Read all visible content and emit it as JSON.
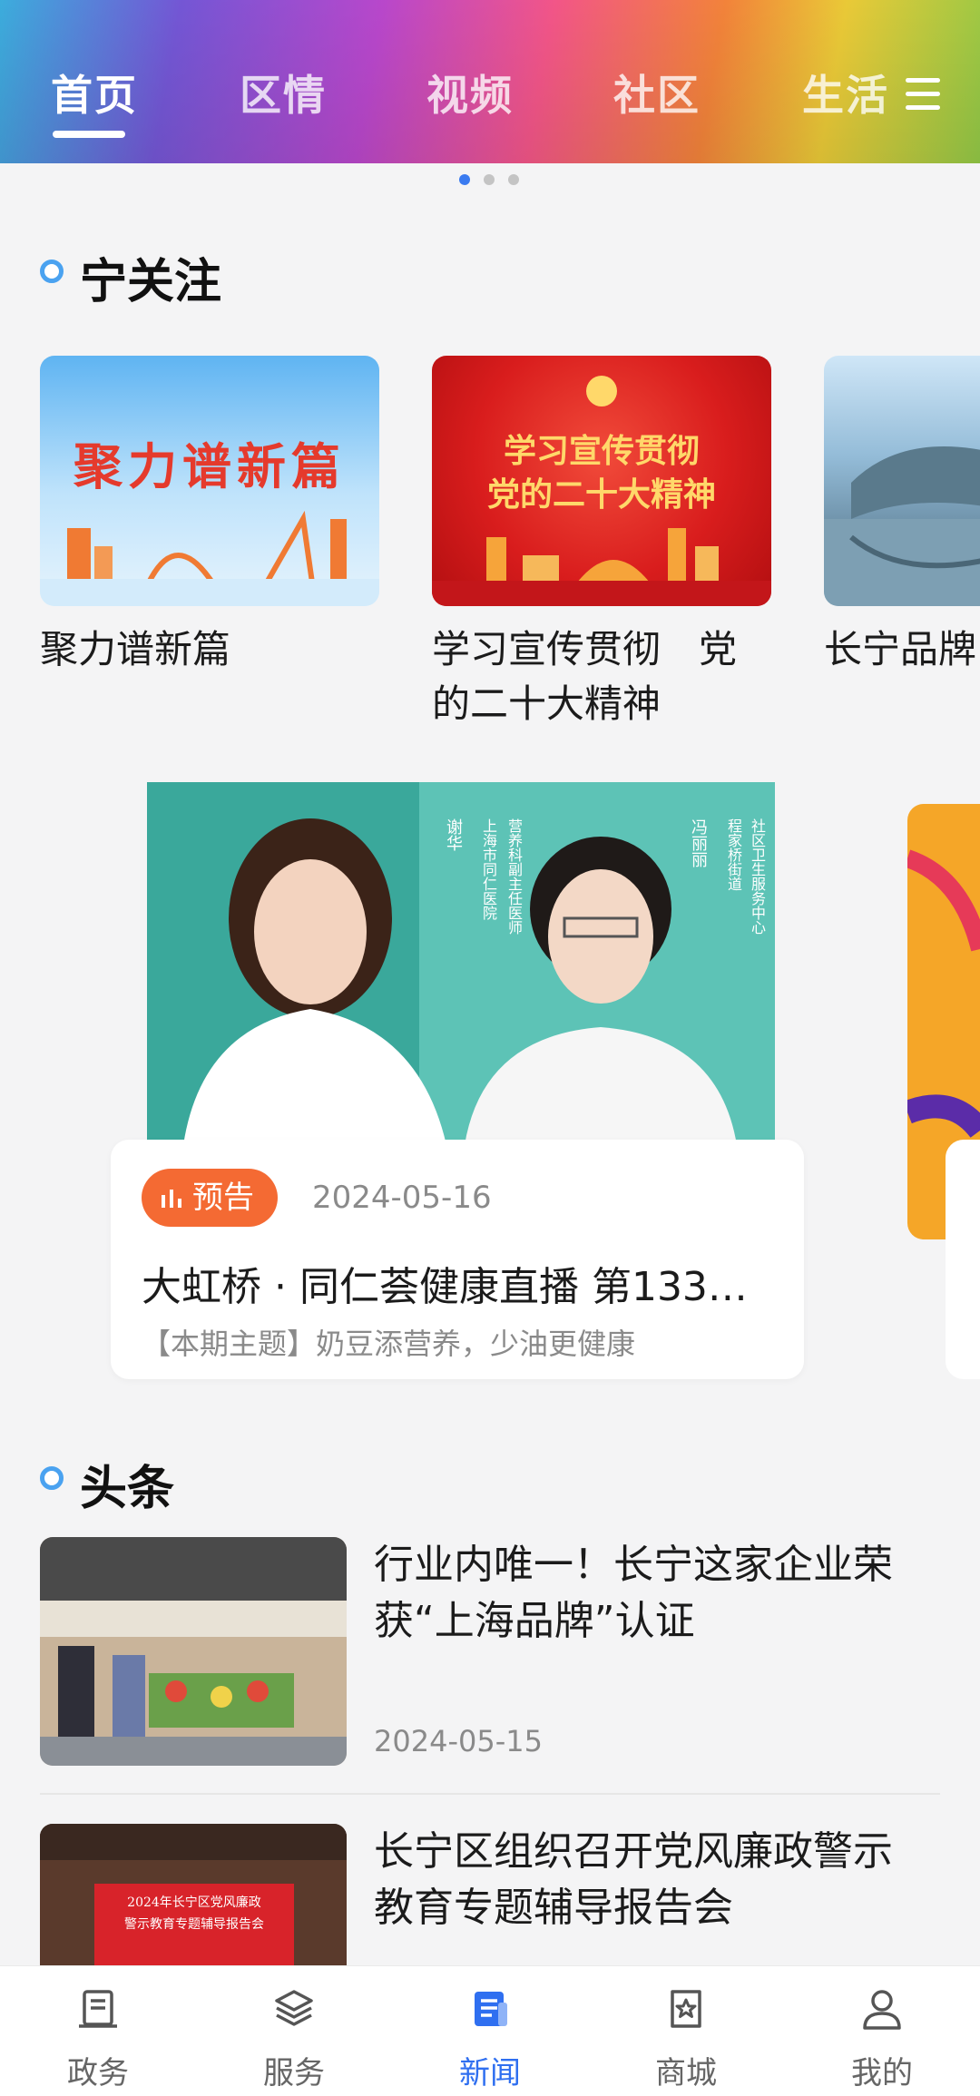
{
  "header": {
    "tabs": [
      {
        "label": "首页",
        "active": true
      },
      {
        "label": "区情",
        "active": false
      },
      {
        "label": "视频",
        "active": false
      },
      {
        "label": "社区",
        "active": false
      },
      {
        "label": "生活",
        "active": false
      }
    ],
    "menu_icon": "hamburger-menu-icon"
  },
  "carousel": {
    "pages": 3,
    "active_index": 0
  },
  "focus": {
    "title": "宁关注",
    "cards": [
      {
        "image_text": "聚力谱新篇",
        "caption": "聚力谱新篇"
      },
      {
        "image_text_line1": "学习宣传贯彻",
        "image_text_line2": "党的二十大精神",
        "caption_line1": "学习宣传贯彻　党",
        "caption_line2": "的二十大精神"
      },
      {
        "caption": "长宁品牌"
      }
    ]
  },
  "live": {
    "badge": "预告",
    "date": "2024-05-16",
    "title": "大虹桥 · 同仁荟健康直播 第133…",
    "subtitle": "【本期主题】奶豆添营养，少油更健康",
    "photo_text_left_name": "谢华",
    "photo_text_left_org": "上海市同仁医院",
    "photo_text_left_role": "营养科副主任医师",
    "photo_text_right_name": "冯丽丽",
    "photo_text_right_org": "程家桥街道",
    "photo_text_right_role": "社区卫生服务中心"
  },
  "headlines": {
    "title": "头条",
    "items": [
      {
        "title_line1": "行业内唯一！长宁这家企业荣",
        "title_line2": "获“上海品牌”认证",
        "date": "2024-05-15"
      },
      {
        "title_line1": "长宁区组织召开党风廉政警示",
        "title_line2": "教育专题辅导报告会",
        "thumb_line1": "2024年长宁区党风廉政",
        "thumb_line2": "警示教育专题辅导报告会"
      }
    ]
  },
  "bottom_nav": [
    {
      "label": "政务",
      "icon": "government-icon",
      "active": false
    },
    {
      "label": "服务",
      "icon": "layers-icon",
      "active": false
    },
    {
      "label": "新闻",
      "icon": "news-icon",
      "active": true
    },
    {
      "label": "商城",
      "icon": "shop-icon",
      "active": false
    },
    {
      "label": "我的",
      "icon": "user-icon",
      "active": false
    }
  ],
  "colors": {
    "accent_blue": "#2f6ff0",
    "badge_orange": "#f46a33",
    "section_dot": "#4aa2f0"
  }
}
